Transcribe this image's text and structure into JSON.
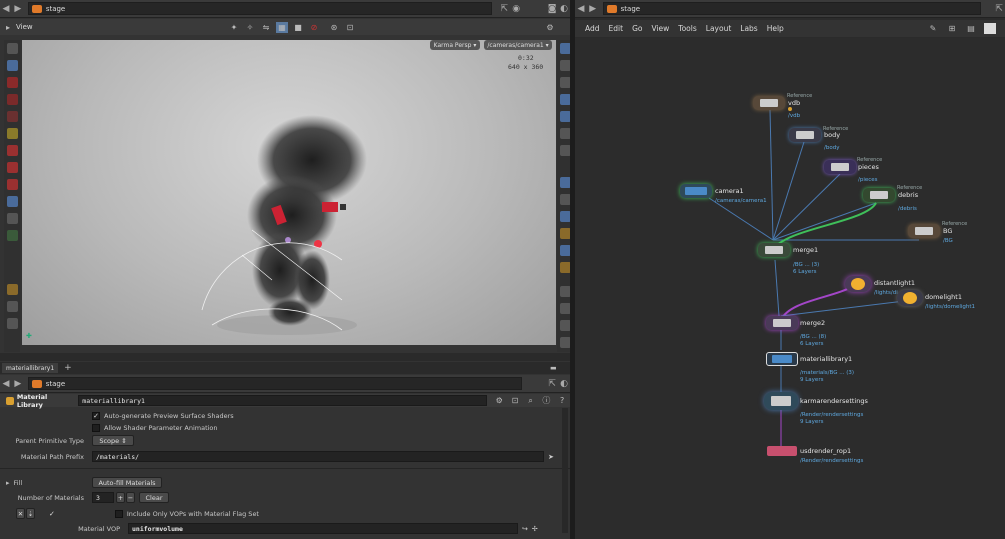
{
  "left_pane": {
    "top_path": "stage",
    "view_tab": "View",
    "camera_menu": "Karma Persp",
    "camera_path": "/cameras/camera1",
    "time_readout": "0:32",
    "resolution_readout": "640 x 360"
  },
  "params_pane": {
    "tab_label": "materiallibrary1",
    "path": "stage",
    "node_type": "Material Library",
    "node_name": "materiallibrary1",
    "auto_generate_label": "Auto-generate Preview Surface Shaders",
    "allow_anim_label": "Allow Shader Parameter Animation",
    "parent_prim_type_label": "Parent Primitive Type",
    "parent_prim_type_value": "Scope",
    "material_path_prefix_label": "Material Path Prefix",
    "material_path_prefix_value": "/materials/",
    "fill_label": "Fill",
    "auto_fill_button": "Auto-fill Materials",
    "num_materials_label": "Number of Materials",
    "num_materials_value": "3",
    "clear_button": "Clear",
    "include_only_label": "Include Only VOPs with Material Flag Set",
    "material_vop_label": "Material VOP",
    "material_vop_value": "uniformvolume"
  },
  "right_pane": {
    "path": "stage",
    "menu": [
      "Add",
      "Edit",
      "Go",
      "View",
      "Tools",
      "Layout",
      "Labs",
      "Help"
    ]
  },
  "nodes": {
    "vdb": {
      "name": "vdb",
      "path": "/vdb",
      "tag": "Reference"
    },
    "body": {
      "name": "body",
      "path": "/body",
      "tag": "Reference"
    },
    "pieces": {
      "name": "pieces",
      "path": "/pieces",
      "tag": "Reference"
    },
    "debris": {
      "name": "debris",
      "path": "/debris",
      "tag": "Reference"
    },
    "camera1": {
      "name": "camera1",
      "path": "/cameras/camera1"
    },
    "bg": {
      "name": "BG",
      "path": "/BG",
      "tag": "Reference"
    },
    "merge1": {
      "name": "merge1",
      "path": "/BG ... (3)",
      "sub": "6 Layers"
    },
    "distantlight1": {
      "name": "distantlight1",
      "path": "/lights/di"
    },
    "domelight1": {
      "name": "domelight1",
      "path": "/lights/domelight1"
    },
    "merge2": {
      "name": "merge2",
      "path": "/BG ... (8)",
      "sub": "6 Layers"
    },
    "materiallibrary1": {
      "name": "materiallibrary1",
      "path": "/materials/BG ... (3)",
      "sub": "9 Layers"
    },
    "karmarendersettings": {
      "name": "karmarendersettings",
      "path": "/Render/rendersettings",
      "sub": "9 Layers"
    },
    "usdrender_rop1": {
      "name": "usdrender_rop1",
      "path": "/Render/rendersettings"
    }
  }
}
